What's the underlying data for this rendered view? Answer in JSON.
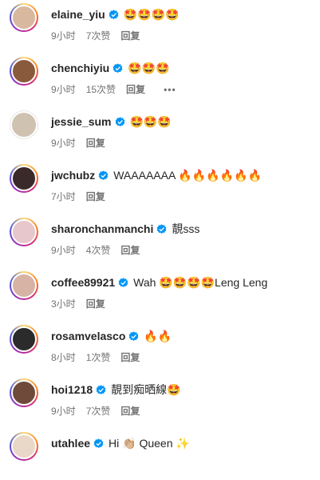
{
  "comments": [
    {
      "username": "elaine_yiu",
      "verified": true,
      "text": "🤩🤩🤩🤩",
      "time": "9小时",
      "likes": "7次赞",
      "reply": "回复",
      "more": "",
      "avatar": {
        "bg": "#d9b8a0",
        "ring": true
      }
    },
    {
      "username": "chenchiyiu",
      "verified": true,
      "text": "🤩🤩🤩",
      "time": "9小时",
      "likes": "15次赞",
      "reply": "回复",
      "more": "•••",
      "avatar": {
        "bg": "#8a5a3c",
        "ring": true
      }
    },
    {
      "username": "jessie_sum",
      "verified": true,
      "text": "🤩🤩🤩",
      "time": "9小时",
      "likes": "",
      "reply": "回复",
      "more": "",
      "avatar": {
        "bg": "#cfc2b0",
        "ring": false
      }
    },
    {
      "username": "jwchubz",
      "verified": true,
      "text": "WAAAAAAA 🔥🔥🔥🔥🔥🔥",
      "time": "7小时",
      "likes": "",
      "reply": "回复",
      "more": "",
      "avatar": {
        "bg": "#3b2a2a",
        "ring": true
      }
    },
    {
      "username": "sharonchanmanchi",
      "verified": true,
      "text": "靚sss",
      "time": "9小时",
      "likes": "4次赞",
      "reply": "回复",
      "more": "",
      "avatar": {
        "bg": "#e7c6cc",
        "ring": true
      }
    },
    {
      "username": "coffee89921",
      "verified": true,
      "text": "Wah 🤩🤩🤩🤩Leng Leng",
      "time": "3小时",
      "likes": "",
      "reply": "回复",
      "more": "",
      "avatar": {
        "bg": "#d7b3a6",
        "ring": true
      }
    },
    {
      "username": "rosamvelasco",
      "verified": true,
      "text": "🔥🔥",
      "time": "8小时",
      "likes": "1次赞",
      "reply": "回复",
      "more": "",
      "avatar": {
        "bg": "#2b2b2b",
        "ring": true
      }
    },
    {
      "username": "hoi1218",
      "verified": true,
      "text": "靚到痴晒線🤩",
      "time": "9小时",
      "likes": "7次赞",
      "reply": "回复",
      "more": "",
      "avatar": {
        "bg": "#6f4a3a",
        "ring": true
      }
    },
    {
      "username": "utahlee",
      "verified": true,
      "text": "Hi 👏🏼 Queen ✨",
      "time": "",
      "likes": "",
      "reply": "",
      "more": "",
      "avatar": {
        "bg": "#e9d7c8",
        "ring": true
      }
    }
  ],
  "colors": {
    "verified_blue": "#0095f6",
    "text_primary": "#262626",
    "text_secondary": "#737373"
  }
}
